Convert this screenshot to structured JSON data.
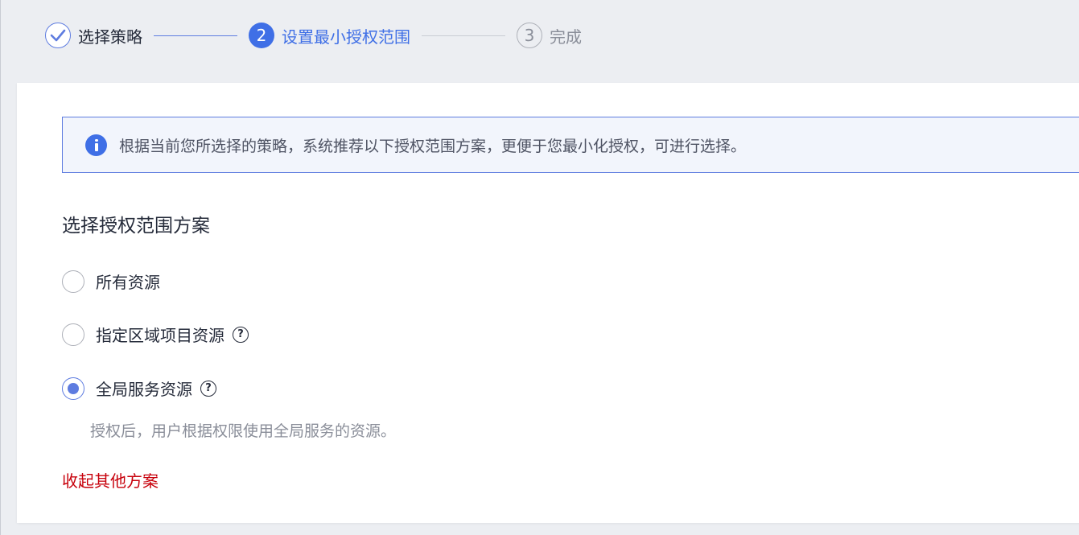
{
  "steps": [
    {
      "label": "选择策略",
      "state": "done"
    },
    {
      "number": "2",
      "label": "设置最小授权范围",
      "state": "active"
    },
    {
      "number": "3",
      "label": "完成",
      "state": "todo"
    }
  ],
  "notice": {
    "icon": "info-icon",
    "text": "根据当前您所选择的策略，系统推荐以下授权范围方案，更便于您最小化授权，可进行选择。"
  },
  "section_title": "选择授权范围方案",
  "options": [
    {
      "label": "所有资源",
      "checked": false,
      "has_help": false
    },
    {
      "label": "指定区域项目资源",
      "checked": false,
      "has_help": true
    },
    {
      "label": "全局服务资源",
      "checked": true,
      "has_help": true
    }
  ],
  "help_glyph": "?",
  "selected_description": "授权后，用户根据权限使用全局服务的资源。",
  "collapse_link": "收起其他方案",
  "colors": {
    "accent": "#3f6fe6",
    "link_red": "#c7000b",
    "notice_bg": "#f2f5fc"
  }
}
